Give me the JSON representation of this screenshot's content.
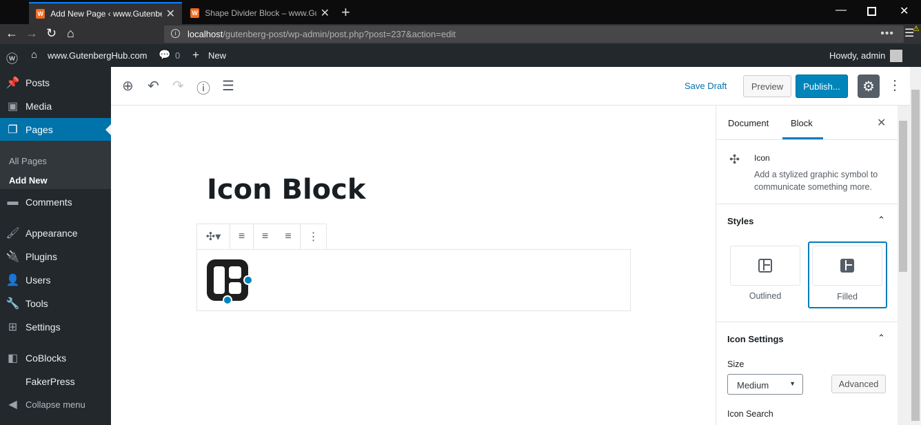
{
  "browser": {
    "tabs": [
      {
        "title": "Add New Page ‹ www.Gutenbe",
        "favicon": "wordpress-favicon"
      },
      {
        "title": "Shape Divider Block – www.Gut",
        "favicon": "wordpress-favicon"
      }
    ],
    "url_host": "localhost",
    "url_path": "/gutenberg-post/wp-admin/post.php?post=237&action=edit"
  },
  "admin_bar": {
    "site_name": "www.GutenbergHub.com",
    "comments_count": "0",
    "new_label": "New",
    "howdy": "Howdy, admin"
  },
  "sidebar": {
    "items": [
      {
        "label": "Posts",
        "icon": "pin-icon"
      },
      {
        "label": "Media",
        "icon": "media-icon"
      },
      {
        "label": "Pages",
        "icon": "pages-icon"
      },
      {
        "label": "Comments",
        "icon": "comment-icon"
      },
      {
        "label": "Appearance",
        "icon": "brush-icon"
      },
      {
        "label": "Plugins",
        "icon": "plug-icon"
      },
      {
        "label": "Users",
        "icon": "user-icon"
      },
      {
        "label": "Tools",
        "icon": "wrench-icon"
      },
      {
        "label": "Settings",
        "icon": "settings-icon"
      },
      {
        "label": "CoBlocks",
        "icon": "coblocks-icon"
      },
      {
        "label": "FakerPress",
        "icon": ""
      },
      {
        "label": "Collapse menu",
        "icon": "collapse-icon"
      }
    ],
    "submenu": [
      "All Pages",
      "Add New"
    ]
  },
  "toolbar": {
    "save_draft": "Save Draft",
    "preview": "Preview",
    "publish": "Publish..."
  },
  "editor": {
    "title": "Icon Block"
  },
  "panel": {
    "tabs": [
      "Document",
      "Block"
    ],
    "active_tab": "Block",
    "block_name": "Icon",
    "block_desc": "Add a stylized graphic symbol to communicate something more.",
    "styles_title": "Styles",
    "styles": [
      "Outlined",
      "Filled"
    ],
    "selected_style": "Filled",
    "icon_settings_title": "Icon Settings",
    "size_label": "Size",
    "size_value": "Medium",
    "advanced": "Advanced",
    "icon_search": "Icon Search"
  },
  "colors": {
    "accent": "#0073aa",
    "publish": "#0085ba",
    "admin_bg": "#23282d"
  }
}
